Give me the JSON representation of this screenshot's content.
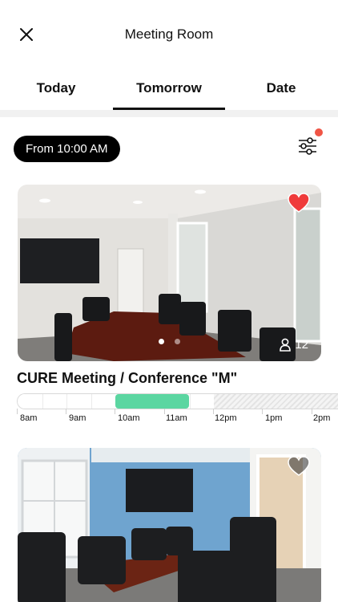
{
  "header": {
    "title": "Meeting Room",
    "close_icon": "close-icon"
  },
  "tabs": [
    {
      "label": "Today",
      "active": false
    },
    {
      "label": "Tomorrow",
      "active": true
    },
    {
      "label": "Date",
      "active": false
    }
  ],
  "filter": {
    "time_label": "From 10:00 AM",
    "filter_icon": "sliders-icon",
    "has_notification": true
  },
  "colors": {
    "accent_booked": "#5bd6a1",
    "heart_red": "#ef3b3b",
    "notification_dot": "#f05545",
    "pill_bg": "#000000"
  },
  "rooms": [
    {
      "name": "CURE Meeting / Conference \"M\"",
      "capacity": "12",
      "favorite": true,
      "carousel_active_index": 0,
      "carousel_count": 2,
      "timeline": {
        "hour_labels": [
          "8am",
          "9am",
          "10am",
          "11am",
          "12pm",
          "1pm",
          "2pm"
        ],
        "booked_from": "10am",
        "booked_to": "11:30am",
        "unavailable_from": "12pm"
      }
    },
    {
      "name": "",
      "favorite": false
    }
  ]
}
